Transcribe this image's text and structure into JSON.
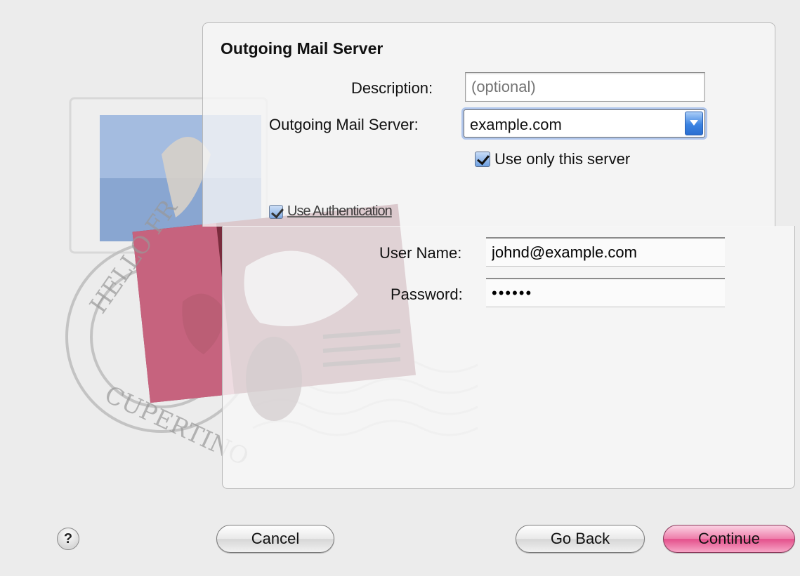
{
  "panel": {
    "title": "Outgoing Mail Server"
  },
  "description": {
    "label": "Description:",
    "placeholder": "(optional)",
    "value": ""
  },
  "server": {
    "label": "Outgoing Mail Server:",
    "value": "example.com"
  },
  "use_only": {
    "label": "Use only this server",
    "checked": true
  },
  "authentication": {
    "label": "Use Authentication",
    "checked": true
  },
  "user_name": {
    "label": "User Name:",
    "value": "johnd@example.com"
  },
  "password": {
    "label": "Password:",
    "value": "••••••"
  },
  "stamp": {
    "postmark_text": "HELLO FROM CUPERTINO, CA"
  },
  "buttons": {
    "help": "?",
    "cancel": "Cancel",
    "go_back": "Go Back",
    "continue": "Continue"
  },
  "colors": {
    "accent_blue": "#3b83e2",
    "default_button_pink": "#e44f8b"
  },
  "icons": {
    "dropdown": "chevron-down-icon",
    "stamp": "mail-stamp-icon",
    "help": "help-icon"
  }
}
